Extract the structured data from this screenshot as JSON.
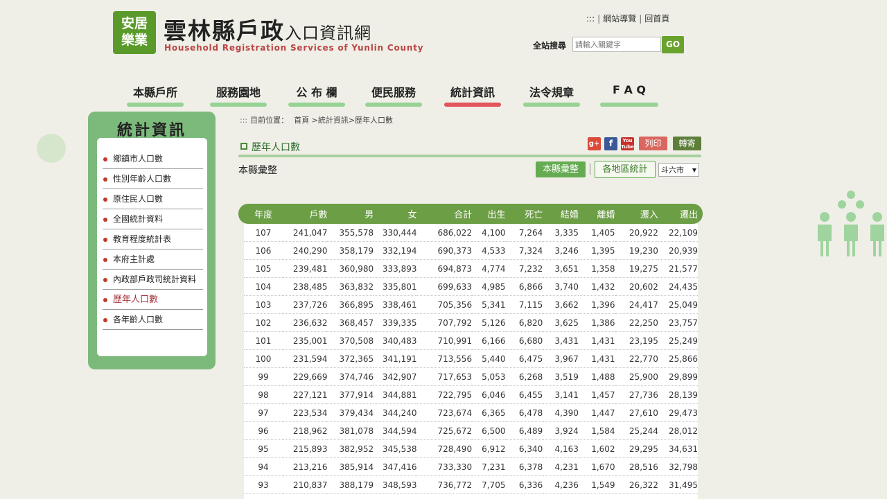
{
  "header": {
    "badge_line1": "安居",
    "badge_line2": "樂業",
    "title_main": "雲林縣戶政",
    "title_small": "入口資訊網",
    "subtitle": "Household Registration Services of Yunlin County",
    "top_prefix": ":::",
    "sitemap": "網站導覽",
    "home": "回首頁",
    "search_label": "全站搜尋",
    "search_placeholder": "請輸入關鍵字",
    "search_button": "GO"
  },
  "nav": [
    {
      "label": "本縣戶所"
    },
    {
      "label": "服務園地"
    },
    {
      "label": "公 布 欄"
    },
    {
      "label": "便民服務"
    },
    {
      "label": "統計資訊"
    },
    {
      "label": "法令規章"
    },
    {
      "label": "F A Q"
    }
  ],
  "sidebar": {
    "title": "統計資訊",
    "items": [
      {
        "label": "鄉鎮市人口數"
      },
      {
        "label": "性別年齡人口數"
      },
      {
        "label": "原住民人口數"
      },
      {
        "label": "全國統計資料"
      },
      {
        "label": "教育程度統計表"
      },
      {
        "label": "本府主計處"
      },
      {
        "label": "內政部戶政司統計資料"
      },
      {
        "label": "歷年人口數"
      },
      {
        "label": "各年齡人口數"
      }
    ]
  },
  "breadcrumb": {
    "prefix": ":::",
    "label": "目前位置：",
    "path": "首頁 >統計資訊>歷年人口數"
  },
  "page": {
    "heading": "歷年人口數",
    "subtitle": "本縣彙整",
    "print": "列印",
    "send": "轉寄",
    "tab_county": "本縣彙整",
    "tab_region": "各地區統計",
    "region_selected": "斗六市",
    "share_icons": [
      "google-plus-icon",
      "facebook-icon",
      "youtube-icon"
    ]
  },
  "table": {
    "headers": [
      "年度",
      "戶數",
      "男",
      "女",
      "合計",
      "出生",
      "死亡",
      "結婚",
      "離婚",
      "遷入",
      "遷出"
    ],
    "rows": [
      [
        "107",
        "241,047",
        "355,578",
        "330,444",
        "686,022",
        "4,100",
        "7,264",
        "3,335",
        "1,405",
        "20,922",
        "22,109"
      ],
      [
        "106",
        "240,290",
        "358,179",
        "332,194",
        "690,373",
        "4,533",
        "7,324",
        "3,246",
        "1,395",
        "19,230",
        "20,939"
      ],
      [
        "105",
        "239,481",
        "360,980",
        "333,893",
        "694,873",
        "4,774",
        "7,232",
        "3,651",
        "1,358",
        "19,275",
        "21,577"
      ],
      [
        "104",
        "238,485",
        "363,832",
        "335,801",
        "699,633",
        "4,985",
        "6,866",
        "3,740",
        "1,432",
        "20,602",
        "24,435"
      ],
      [
        "103",
        "237,726",
        "366,895",
        "338,461",
        "705,356",
        "5,341",
        "7,115",
        "3,662",
        "1,396",
        "24,417",
        "25,049"
      ],
      [
        "102",
        "236,632",
        "368,457",
        "339,335",
        "707,792",
        "5,126",
        "6,820",
        "3,625",
        "1,386",
        "22,250",
        "23,757"
      ],
      [
        "101",
        "235,001",
        "370,508",
        "340,483",
        "710,991",
        "6,166",
        "6,680",
        "3,431",
        "1,431",
        "23,195",
        "25,249"
      ],
      [
        "100",
        "231,594",
        "372,365",
        "341,191",
        "713,556",
        "5,440",
        "6,475",
        "3,967",
        "1,431",
        "22,770",
        "25,866"
      ],
      [
        "99",
        "229,669",
        "374,746",
        "342,907",
        "717,653",
        "5,053",
        "6,268",
        "3,519",
        "1,488",
        "25,900",
        "29,899"
      ],
      [
        "98",
        "227,121",
        "377,914",
        "344,881",
        "722,795",
        "6,046",
        "6,455",
        "3,141",
        "1,457",
        "27,736",
        "28,139"
      ],
      [
        "97",
        "223,534",
        "379,434",
        "344,240",
        "723,674",
        "6,365",
        "6,478",
        "4,390",
        "1,447",
        "27,610",
        "29,473"
      ],
      [
        "96",
        "218,962",
        "381,078",
        "344,594",
        "725,672",
        "6,500",
        "6,489",
        "3,924",
        "1,584",
        "25,244",
        "28,012"
      ],
      [
        "95",
        "215,893",
        "382,952",
        "345,538",
        "728,490",
        "6,912",
        "6,340",
        "4,163",
        "1,602",
        "29,295",
        "34,631"
      ],
      [
        "94",
        "213,216",
        "385,914",
        "347,416",
        "733,330",
        "7,231",
        "6,378",
        "4,231",
        "1,670",
        "28,516",
        "32,798"
      ],
      [
        "93",
        "210,837",
        "388,179",
        "348,593",
        "736,772",
        "7,705",
        "6,336",
        "4,236",
        "1,549",
        "26,322",
        "31,495"
      ]
    ]
  },
  "colors": {
    "brand_green": "#6c9e45",
    "sidebar_green": "#7cba7c",
    "active_red": "#e0444a",
    "page_bg": "#efefe7"
  }
}
